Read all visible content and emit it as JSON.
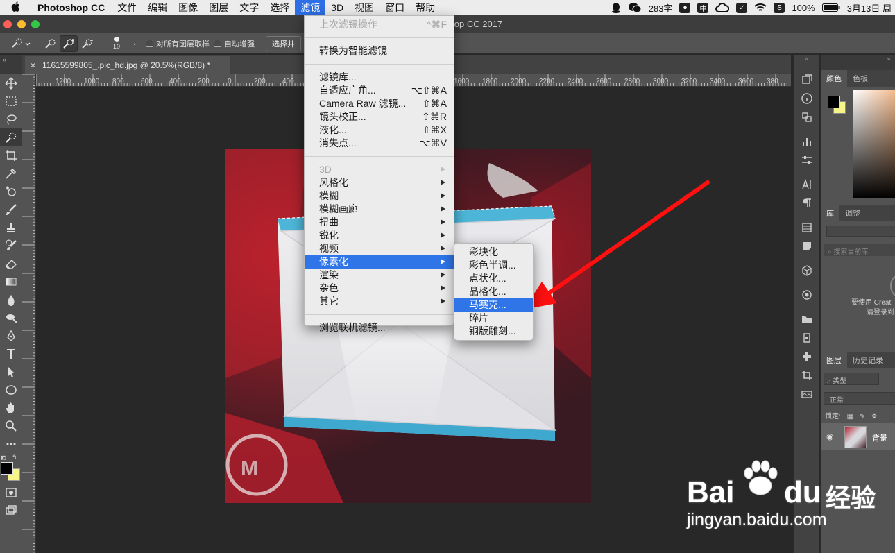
{
  "menubar": {
    "app_name": "Photoshop CC",
    "items": [
      "文件",
      "编辑",
      "图像",
      "图层",
      "文字",
      "选择",
      "滤镜",
      "3D",
      "视图",
      "窗口",
      "帮助"
    ],
    "active_index": 6,
    "tray": {
      "word_count": "283字",
      "battery": "100%",
      "date": "3月13日 周"
    }
  },
  "window": {
    "title": "Adobe Photoshop CC 2017"
  },
  "options": {
    "brush_size": "10",
    "sample_all_layers": "对所有图层取样",
    "auto_enhance": "自动增强",
    "select_button": "选择并"
  },
  "document_tab": {
    "title": "11615599805_.pic_hd.jpg @ 20.5%(RGB/8) *",
    "close": "×"
  },
  "ruler_labels": [
    "1200",
    "1000",
    "800",
    "600",
    "400",
    "200",
    "0",
    "200",
    "400",
    "1600",
    "1800",
    "2000",
    "2200",
    "2400",
    "2600",
    "2800",
    "3000",
    "3200",
    "3400",
    "3600",
    "380"
  ],
  "filter_menu": {
    "last_filter": {
      "label": "上次滤镜操作",
      "shortcut": "^⌘F"
    },
    "smart_filter": "转换为智能滤镜",
    "group1": [
      {
        "label": "滤镜库...",
        "shortcut": ""
      },
      {
        "label": "自适应广角...",
        "shortcut": "⌥⇧⌘A"
      },
      {
        "label": "Camera Raw 滤镜...",
        "shortcut": "⇧⌘A"
      },
      {
        "label": "镜头校正...",
        "shortcut": "⇧⌘R"
      },
      {
        "label": "液化...",
        "shortcut": "⇧⌘X"
      },
      {
        "label": "消失点...",
        "shortcut": "⌥⌘V"
      }
    ],
    "submenus": [
      {
        "label": "3D",
        "disabled": true
      },
      {
        "label": "风格化"
      },
      {
        "label": "模糊"
      },
      {
        "label": "模糊画廊"
      },
      {
        "label": "扭曲"
      },
      {
        "label": "锐化"
      },
      {
        "label": "视频"
      },
      {
        "label": "像素化",
        "highlighted": true
      },
      {
        "label": "渲染"
      },
      {
        "label": "杂色"
      },
      {
        "label": "其它"
      }
    ],
    "browse": "浏览联机滤镜..."
  },
  "pixelate_menu": {
    "items": [
      "彩块化",
      "彩色半调...",
      "点状化...",
      "晶格化...",
      "马赛克...",
      "碎片",
      "铜版雕刻..."
    ],
    "highlighted_index": 4
  },
  "panels": {
    "color_tabs": [
      "颜色",
      "色板"
    ],
    "library_tabs": [
      "库",
      "调整"
    ],
    "library_search": "搜索当前库",
    "library_msg1": "要使用 Creat",
    "library_msg2": "请登录到",
    "layers_tabs": [
      "图层",
      "历史记录"
    ],
    "kind_filter": "类型",
    "blend_mode": "正常",
    "lock_label": "锁定:",
    "layer_name": "背景"
  },
  "watermark": {
    "brand": "Bai",
    "brand2": "du",
    "cn": "经验",
    "url": "jingyan.baidu.com"
  },
  "colors": {
    "menu_highlight": "#2f75e8",
    "panel_bg": "#535353",
    "canvas_bg": "#282828",
    "foreground": "#000000",
    "background": "#f5f58a"
  }
}
